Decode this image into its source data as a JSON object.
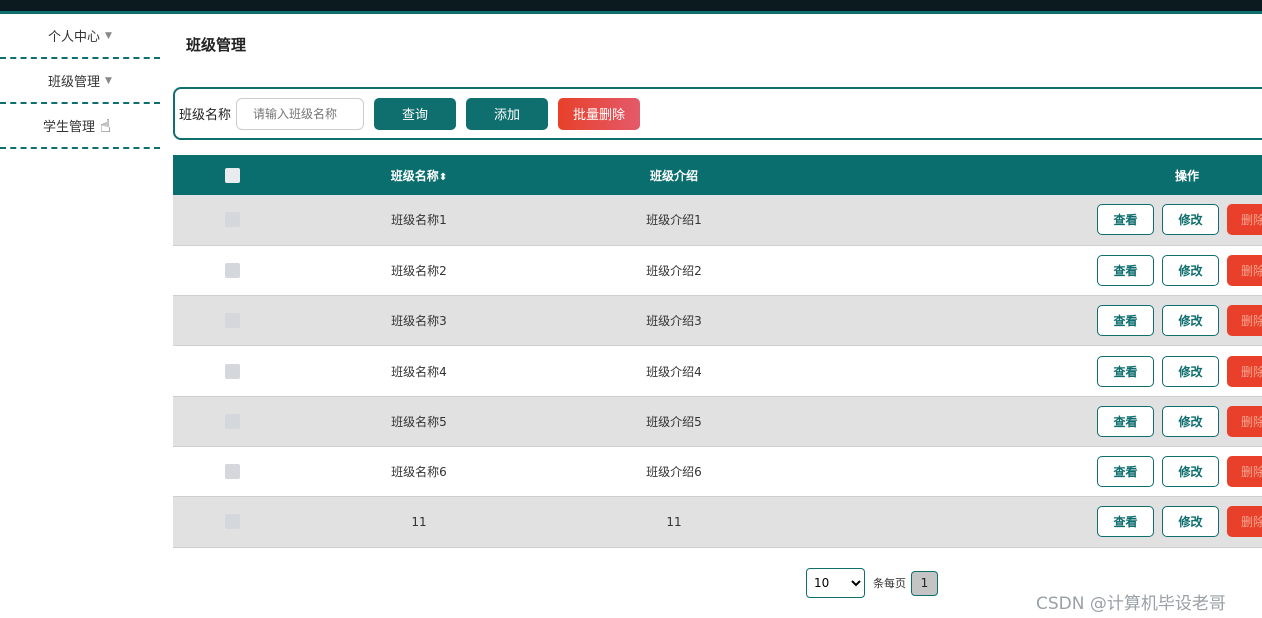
{
  "sidebar": {
    "items": [
      {
        "label": "个人中心"
      },
      {
        "label": "班级管理"
      },
      {
        "label": "学生管理"
      }
    ]
  },
  "page": {
    "title": "班级管理"
  },
  "search": {
    "label": "班级名称",
    "placeholder": "请输入班级名称",
    "query_label": "查询",
    "add_label": "添加",
    "batch_delete_label": "批量删除"
  },
  "table": {
    "columns": {
      "name": "班级名称",
      "sort_glyph": "⬍",
      "intro": "班级介绍",
      "ops": "操作"
    },
    "actions": {
      "view": "查看",
      "edit": "修改",
      "delete": "删除"
    },
    "rows": [
      {
        "name": "班级名称1",
        "intro": "班级介绍1"
      },
      {
        "name": "班级名称2",
        "intro": "班级介绍2"
      },
      {
        "name": "班级名称3",
        "intro": "班级介绍3"
      },
      {
        "name": "班级名称4",
        "intro": "班级介绍4"
      },
      {
        "name": "班级名称5",
        "intro": "班级介绍5"
      },
      {
        "name": "班级名称6",
        "intro": "班级介绍6"
      },
      {
        "name": "11",
        "intro": "11"
      }
    ]
  },
  "pagination": {
    "page_size": "10",
    "per_page_label": "条每页",
    "current_page": "1"
  },
  "watermark": "CSDN @计算机毕设老哥",
  "colors": {
    "primary": "#0f6e6e",
    "danger": "#e8402a"
  }
}
